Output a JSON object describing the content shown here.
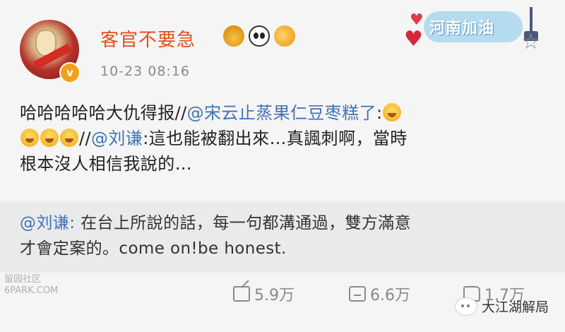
{
  "user": {
    "name": "客官不要急",
    "timestamp": "10-23 08:16",
    "verified_mark": "v"
  },
  "topic_badge": {
    "label": "河南加油"
  },
  "post": {
    "line1_text": "哈哈哈哈哈大仇得报//",
    "line1_mention": "@宋云止蒸果仁豆枣糕了",
    "line1_suffix": ":",
    "line2_prefix": "//",
    "line2_mention": "@刘谦",
    "line2_text": ":這也能被翻出來…真諷刺啊，當時",
    "line3_text": "根本沒人相信我說的…"
  },
  "repost": {
    "mention": "@刘谦:",
    "text_line1": " 在台上所說的話，每一句都溝通過，雙方滿意",
    "text_line2": "才會定案的。come on!be honest."
  },
  "actions": {
    "share_count": "5.9万",
    "comment_count": "6.6万",
    "like_count": "1.7万"
  },
  "watermarks": {
    "left_line1": "留园社区",
    "left_line2": "6PARK.COM",
    "right": "大江湖解局"
  },
  "colors": {
    "username": "#e4501f",
    "mention": "#3f74b5",
    "meta": "#8a8a8a",
    "repost_bg": "#eaeaea"
  },
  "icons": [
    "crown-icon",
    "panda-icon",
    "fish-icon",
    "star-icon",
    "share-icon",
    "comment-icon",
    "like-icon",
    "laugh-cry-emoji",
    "wechat-icon"
  ]
}
